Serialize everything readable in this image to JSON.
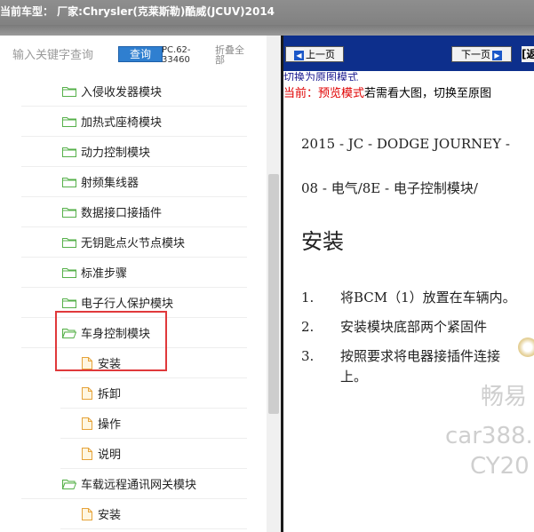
{
  "window": {
    "title": "当前车型：  厂家:Chrysler(克莱斯勒)酷威(JCUV)2014"
  },
  "left_panel": {
    "search_placeholder": "输入关键字查询",
    "query_button": "查询",
    "pc_code": "PC.62-33460",
    "collapse_all": "折叠全部",
    "tree": [
      {
        "label": "入侵收发器模块",
        "type": "folder"
      },
      {
        "label": "加热式座椅模块",
        "type": "folder"
      },
      {
        "label": "动力控制模块",
        "type": "folder"
      },
      {
        "label": "射频集线器",
        "type": "folder"
      },
      {
        "label": "数据接口接插件",
        "type": "folder"
      },
      {
        "label": "无钥匙点火节点模块",
        "type": "folder"
      },
      {
        "label": "标准步骤",
        "type": "folder"
      },
      {
        "label": "电子行人保护模块",
        "type": "folder"
      },
      {
        "label": "车身控制模块",
        "type": "folder-open",
        "highlighted": true
      },
      {
        "label": "安装",
        "type": "page",
        "highlighted": true
      },
      {
        "label": "拆卸",
        "type": "page"
      },
      {
        "label": "操作",
        "type": "page"
      },
      {
        "label": "说明",
        "type": "page"
      },
      {
        "label": "车载远程通讯网关模块",
        "type": "folder-open"
      },
      {
        "label": "安装",
        "type": "page"
      }
    ]
  },
  "right_panel": {
    "prev_button": "上一页",
    "next_button": "下一页",
    "extra_button": "[返",
    "switch_link": "切换为原图模式",
    "preview_prefix": "当前：预览模式",
    "preview_suffix": "若需看大图，切换至原图",
    "doc": {
      "line1": "2015 - JC - DODGE JOURNEY -",
      "line2": "08 - 电气/8E - 电子控制模块/",
      "heading": "安装",
      "steps": [
        {
          "num": "1.",
          "text": "将BCM（1）放置在车辆内。"
        },
        {
          "num": "2.",
          "text": "安装模块底部两个紧固件"
        },
        {
          "num": "3.",
          "text": "按照要求将电器接插件连接"
        },
        {
          "num": "",
          "text": "上。"
        }
      ]
    },
    "watermark": [
      "畅易",
      "car388.",
      "CY20"
    ]
  },
  "colors": {
    "titlebar": "#8a8a8a",
    "navbar": "#0d2f8c",
    "query_button": "#2f7fd0",
    "highlight_border": "#e0393b",
    "folder_green": "#56b04a"
  }
}
